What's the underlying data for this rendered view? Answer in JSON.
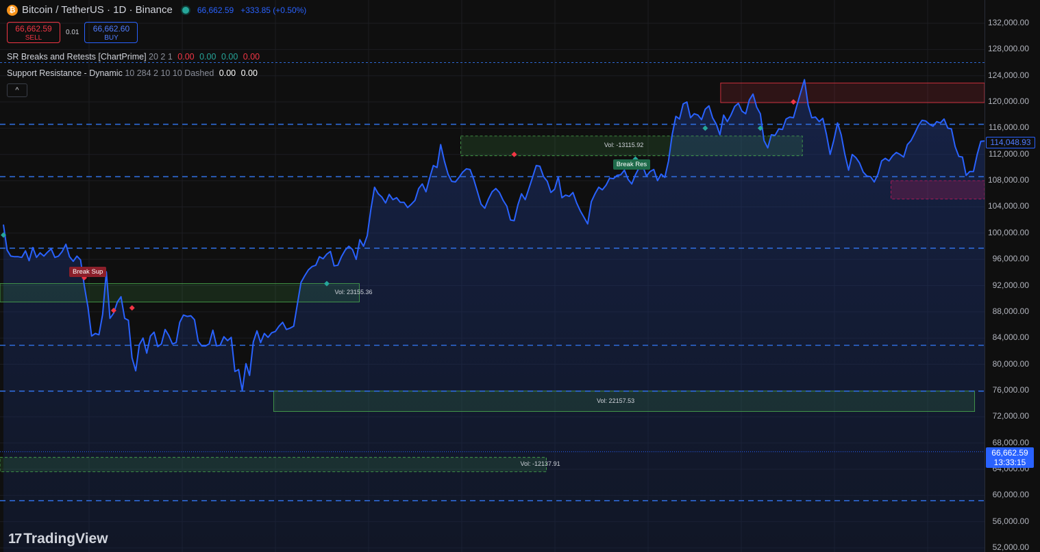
{
  "header": {
    "coin_icon": "bitcoin-icon",
    "coin_glyph": "₿",
    "title": "Bitcoin / TetherUS · 1D · Binance",
    "last_price": "66,662.59",
    "change": "+333.85 (+0.50%)"
  },
  "trade": {
    "sell_price": "66,662.59",
    "sell_label": "SELL",
    "spread": "0.01",
    "buy_price": "66,662.60",
    "buy_label": "BUY"
  },
  "indicators": {
    "sr": {
      "name": "SR Breaks and Retests [ChartPrime]",
      "params": "20 2 1",
      "v1": "0.00",
      "v2": "0.00",
      "v3": "0.00",
      "v4": "0.00"
    },
    "dyn": {
      "name": "Support Resistance - Dynamic",
      "params": "10 284 2 10 10 Dashed",
      "v1": "0.00",
      "v2": "0.00"
    },
    "collapse_icon": "chevron-up-icon",
    "collapse_glyph": "^"
  },
  "price_tags": {
    "last": "114,048.93",
    "current": "66,662.59",
    "countdown": "13:33:15"
  },
  "logo": {
    "mark": "17",
    "text": "TradingView"
  },
  "colors": {
    "line": "#2962ff",
    "support_level": "#2962ff",
    "bullish_zone": "#4caf50",
    "bearish_zone": "#f23645",
    "break_sup": "#8b1f2a",
    "break_res": "#1e6b4a"
  },
  "chart_data": {
    "type": "line",
    "title": "Bitcoin / TetherUS · 1D · Binance",
    "ylim": [
      52000,
      132000
    ],
    "y_ticks": [
      "132,000.00",
      "128,000.00",
      "124,000.00",
      "120,000.00",
      "116,000.00",
      "112,000.00",
      "108,000.00",
      "104,000.00",
      "100,000.00",
      "96,000.00",
      "92,000.00",
      "88,000.00",
      "84,000.00",
      "80,000.00",
      "76,000.00",
      "72,000.00",
      "68,000.00",
      "64,000.00",
      "60,000.00",
      "56,000.00",
      "52,000.00"
    ],
    "series": [
      {
        "values": [
          101300,
          97400,
          96500,
          96400,
          96400,
          96300,
          97300,
          95800,
          97800,
          96300,
          97000,
          96500,
          97100,
          97600,
          96300,
          96500,
          97200,
          98300,
          96400,
          95700,
          96500,
          95900,
          92000,
          88700,
          84300,
          84700,
          84500,
          87600,
          94100,
          87000,
          87800,
          89500,
          90300,
          87000,
          86700,
          81000,
          79000,
          83000,
          84000,
          81700,
          84300,
          84900,
          82700,
          83100,
          85300,
          84400,
          83100,
          83300,
          86400,
          87500,
          87300,
          87400,
          86800,
          83500,
          82800,
          82800,
          83100,
          85200,
          82800,
          82900,
          84200,
          83600,
          84100,
          78900,
          79200,
          76000,
          80100,
          78300,
          83400,
          85100,
          83300,
          84700,
          84100,
          84800,
          85000,
          85800,
          86400,
          85300,
          85500,
          85800,
          89200,
          92500,
          93500,
          94400,
          94900,
          95100,
          96400,
          96100,
          96800,
          97200,
          95000,
          95100,
          96400,
          97400,
          98000,
          97500,
          96000,
          99000,
          98000,
          99600,
          103600,
          107000,
          106000,
          105500,
          104600,
          105900,
          105100,
          105400,
          104700,
          104700,
          103900,
          104400,
          105000,
          106800,
          107500,
          106300,
          108400,
          110300,
          110000,
          113500,
          111000,
          109000,
          107900,
          107800,
          108500,
          109300,
          109800,
          109700,
          108200,
          106300,
          104400,
          103800,
          105200,
          106300,
          106800,
          106200,
          105000,
          104100,
          102000,
          101900,
          104300,
          106000,
          105100,
          106800,
          108500,
          110300,
          110200,
          108600,
          107900,
          106200,
          106700,
          108600,
          105400,
          105800,
          105600,
          106200,
          104600,
          103400,
          102400,
          101400,
          104800,
          106000,
          107000,
          106600,
          107300,
          108400,
          108300,
          108800,
          108900,
          109600,
          108200,
          107500,
          108900,
          110000,
          110200,
          108700,
          109400,
          109700,
          108000,
          109000,
          108500,
          111000,
          115000,
          117800,
          117400,
          119700,
          120000,
          117600,
          118200,
          118000,
          117300,
          118900,
          119400,
          117600,
          116600,
          115000,
          118000,
          117000,
          118000,
          119300,
          119800,
          118600,
          118200,
          120300,
          121200,
          119200,
          118200,
          114100,
          113000,
          115000,
          114900,
          115900,
          115800,
          117400,
          117700,
          117600,
          119600,
          121500,
          123400,
          119500,
          117600,
          117700,
          117000,
          117500,
          115000,
          112000,
          114200,
          116800,
          115000,
          112000,
          109600,
          112000,
          111500,
          110700,
          109300,
          108700,
          108600,
          107800,
          109000,
          111000,
          111400,
          111000,
          111800,
          112300,
          112000,
          111600,
          113500,
          114100,
          115200,
          116400,
          117200,
          117100,
          116600,
          116300,
          117000,
          116800,
          117400,
          116000,
          115900,
          113200,
          111700,
          111600,
          108800,
          109400,
          109400,
          112000,
          114000,
          114048.93
        ]
      }
    ],
    "current_price": 66662.59,
    "sr_levels": [
      126000,
      116600,
      108600,
      97700,
      82900,
      75900,
      59200
    ],
    "zones": [
      {
        "kind": "bullish",
        "y_top": 92300,
        "y_bottom": 89500,
        "x_start": 0,
        "x_end": 0.365,
        "label": "Vol: 23155.36"
      },
      {
        "kind": "bullish",
        "y_top": 114800,
        "y_bottom": 111800,
        "x_start": 0.468,
        "x_end": 0.815,
        "label": "Vol: -13115.92"
      },
      {
        "kind": "bullish",
        "y_top": 75900,
        "y_bottom": 72800,
        "x_start": 0.278,
        "x_end": 0.99,
        "label": "Vol: 22157.53"
      },
      {
        "kind": "bullish",
        "y_top": 65800,
        "y_bottom": 63600,
        "x_start": 0,
        "x_end": 0.555,
        "label": "Vol: -12137.91"
      },
      {
        "kind": "bearish",
        "y_top": 122900,
        "y_bottom": 119900,
        "x_start": 0.732,
        "x_end": 1.0,
        "label": ""
      },
      {
        "kind": "bearish_retest",
        "y_top": 108000,
        "y_bottom": 105200,
        "x_start": 0.905,
        "x_end": 1.0,
        "label": ""
      }
    ],
    "labels": [
      {
        "text": "Break Sup",
        "kind": "break_sup",
        "index": 22,
        "price": 94000
      },
      {
        "text": "Break Res",
        "kind": "break_res",
        "index": 170,
        "price": 110400
      }
    ],
    "markers": [
      {
        "kind": "green",
        "index": 0,
        "price": 99700
      },
      {
        "kind": "red",
        "index": 22,
        "price": 93200
      },
      {
        "kind": "red",
        "index": 30,
        "price": 88200
      },
      {
        "kind": "red",
        "index": 35,
        "price": 88600
      },
      {
        "kind": "green",
        "index": 88,
        "price": 92300
      },
      {
        "kind": "red",
        "index": 139,
        "price": 112000
      },
      {
        "kind": "green",
        "index": 172,
        "price": 111300
      },
      {
        "kind": "green",
        "index": 191,
        "price": 116000
      },
      {
        "kind": "green",
        "index": 206,
        "price": 116000
      },
      {
        "kind": "red",
        "index": 215,
        "price": 120000
      }
    ]
  }
}
